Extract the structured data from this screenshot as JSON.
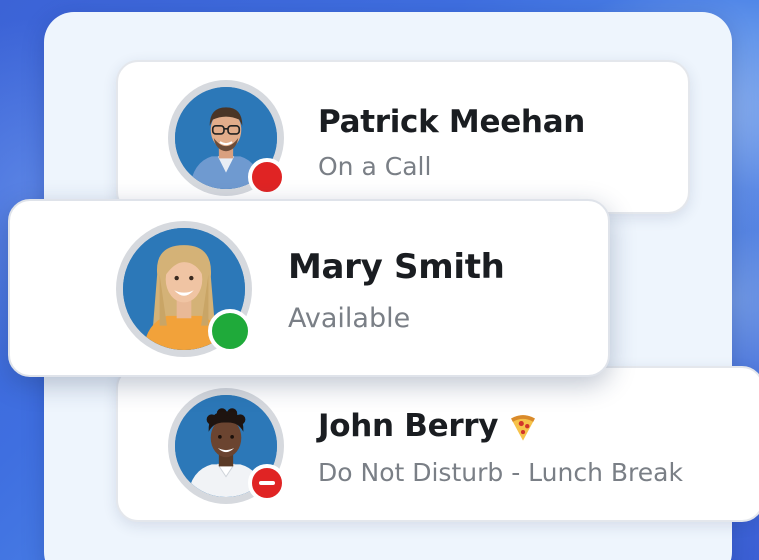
{
  "contacts": [
    {
      "name": "Patrick Meehan",
      "status_text": "On a Call",
      "status": "busy",
      "status_color": "#e02424"
    },
    {
      "name": "Mary Smith",
      "status_text": "Available",
      "status": "available",
      "status_color": "#1faa3a"
    },
    {
      "name": "John Berry",
      "status_text": "Do Not Disturb - Lunch Break",
      "status": "do-not-disturb",
      "status_color": "#e02424",
      "emoji_icon": "pizza-icon"
    }
  ],
  "colors": {
    "avatar_background": "#2c78b8",
    "panel": "#eef5fd",
    "background": "#3f6fe0"
  }
}
